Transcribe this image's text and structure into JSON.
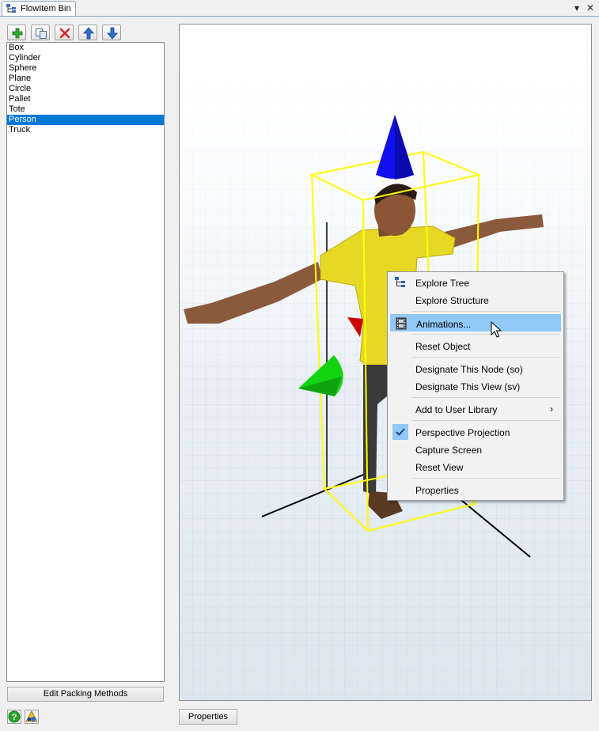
{
  "window": {
    "tab_title": "FlowItem Bin",
    "dropdown_glyph": "▾",
    "close_glyph": "✕"
  },
  "toolbar": {
    "add_icon": "plus-icon",
    "duplicate_icon": "duplicate-icon",
    "delete_icon": "delete-icon",
    "move_up_icon": "arrow-up-icon",
    "move_down_icon": "arrow-down-icon"
  },
  "flowitems": {
    "items": [
      "Box",
      "Cylinder",
      "Sphere",
      "Plane",
      "Circle",
      "Pallet",
      "Tote",
      "Person",
      "Truck"
    ],
    "selected": "Person"
  },
  "buttons": {
    "edit_packing": "Edit Packing Methods",
    "properties": "Properties"
  },
  "status_icons": {
    "help": "help-icon",
    "shapes": "shapes-icon"
  },
  "context_menu": {
    "items": [
      "Explore Tree",
      "Explore Structure",
      "Animations...",
      "Reset Object",
      "Designate This Node (so)",
      "Designate This View (sv)",
      "Add to User Library",
      "Perspective Projection",
      "Capture Screen",
      "Reset View",
      "Properties"
    ],
    "highlighted": "Animations...",
    "checked": "Perspective Projection",
    "submenu_arrow": "›"
  },
  "colors": {
    "selection": "#0078d7",
    "menu_highlight": "#91c9f7",
    "bounding_box": "#ffff00",
    "axis_z_cone": "#0000ff",
    "axis_x_cone": "#00cc00",
    "axis_y_cone": "#cc0000"
  }
}
